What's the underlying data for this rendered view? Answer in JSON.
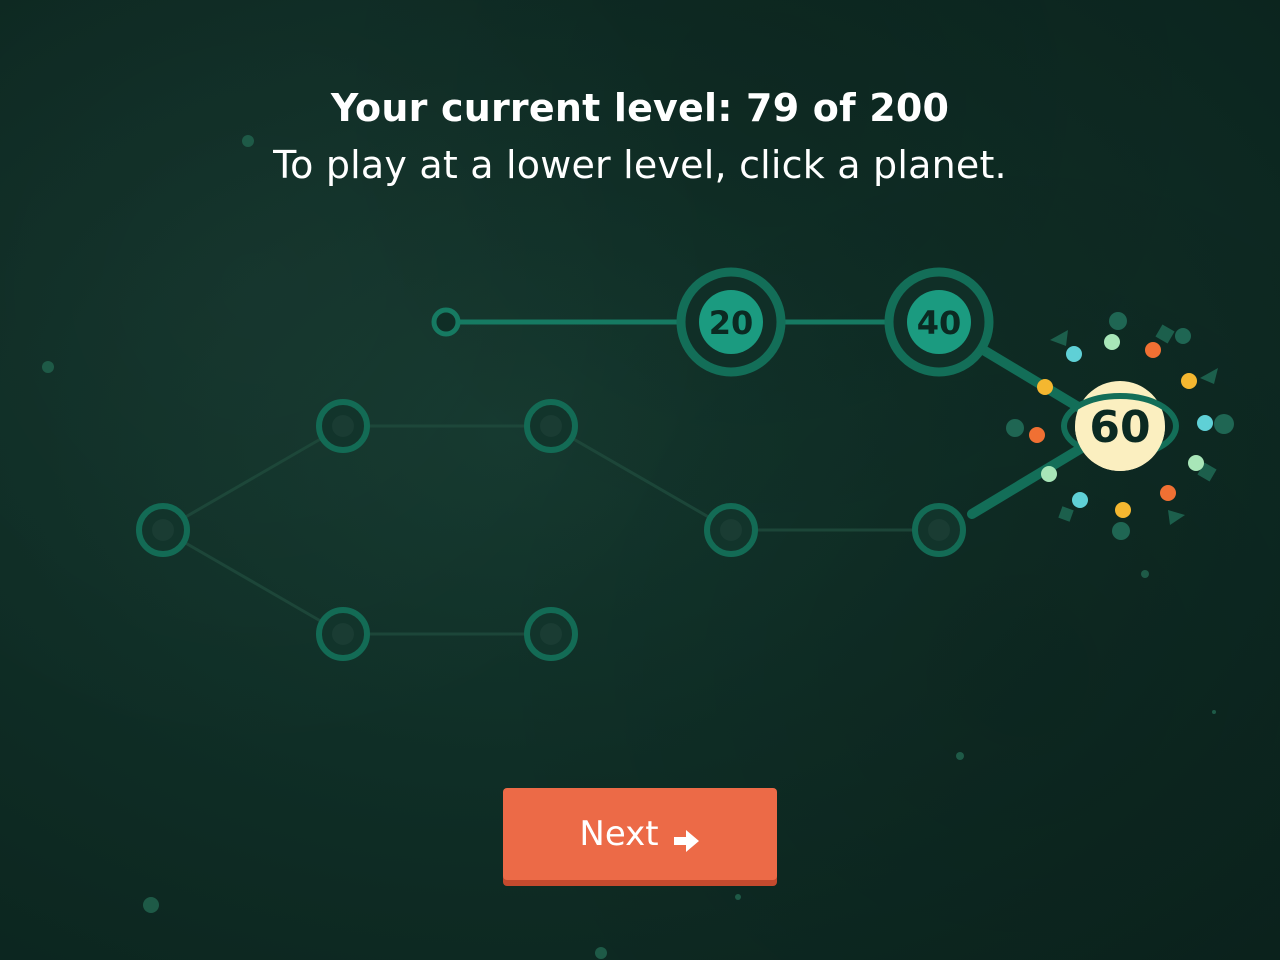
{
  "header": {
    "current_level_text": "Your current level: 79 of 200",
    "instruction_text": "To play at a lower level, click a planet."
  },
  "planets": {
    "level_20": "20",
    "level_40": "40",
    "level_60": "60"
  },
  "next_button": {
    "label": "Next",
    "icon": "arrow-right-icon"
  },
  "colors": {
    "background": "#0f2e26",
    "path_active": "#167a62",
    "planet_fill": "#1b9b80",
    "current_planet": "#fbefc0",
    "button": "#ec6a47"
  }
}
